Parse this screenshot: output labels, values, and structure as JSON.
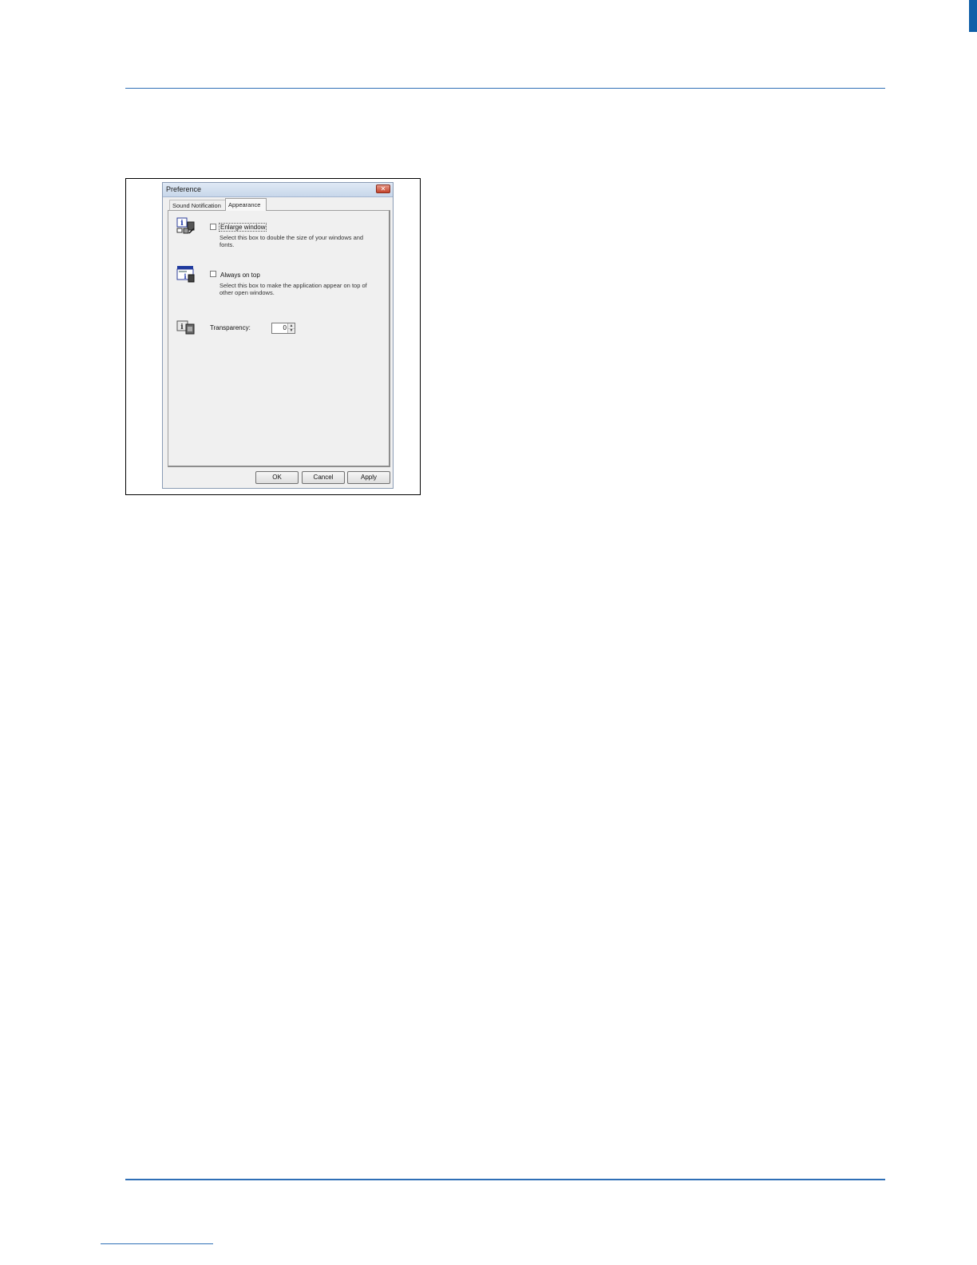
{
  "dialog": {
    "title": "Preference",
    "close_glyph": "✕",
    "tabs": [
      {
        "label": "Sound Notification",
        "active": false
      },
      {
        "label": "Appearance",
        "active": true
      }
    ],
    "options": {
      "enlarge": {
        "label": "Enlarge window",
        "checked": false,
        "description": "Select this box to double the size of your windows and fonts."
      },
      "ontop": {
        "label": "Always on top",
        "checked": false,
        "description": "Select this box to make the application appear on top of other open windows."
      },
      "transparency": {
        "label": "Transparency:",
        "value": "0",
        "up_glyph": "▲",
        "down_glyph": "▼"
      }
    },
    "buttons": {
      "ok": "OK",
      "cancel": "Cancel",
      "apply": "Apply"
    }
  },
  "colors": {
    "rule": "#2f6fb6",
    "edge_tab": "#0f5fa8",
    "close_button": "#c4432b"
  }
}
